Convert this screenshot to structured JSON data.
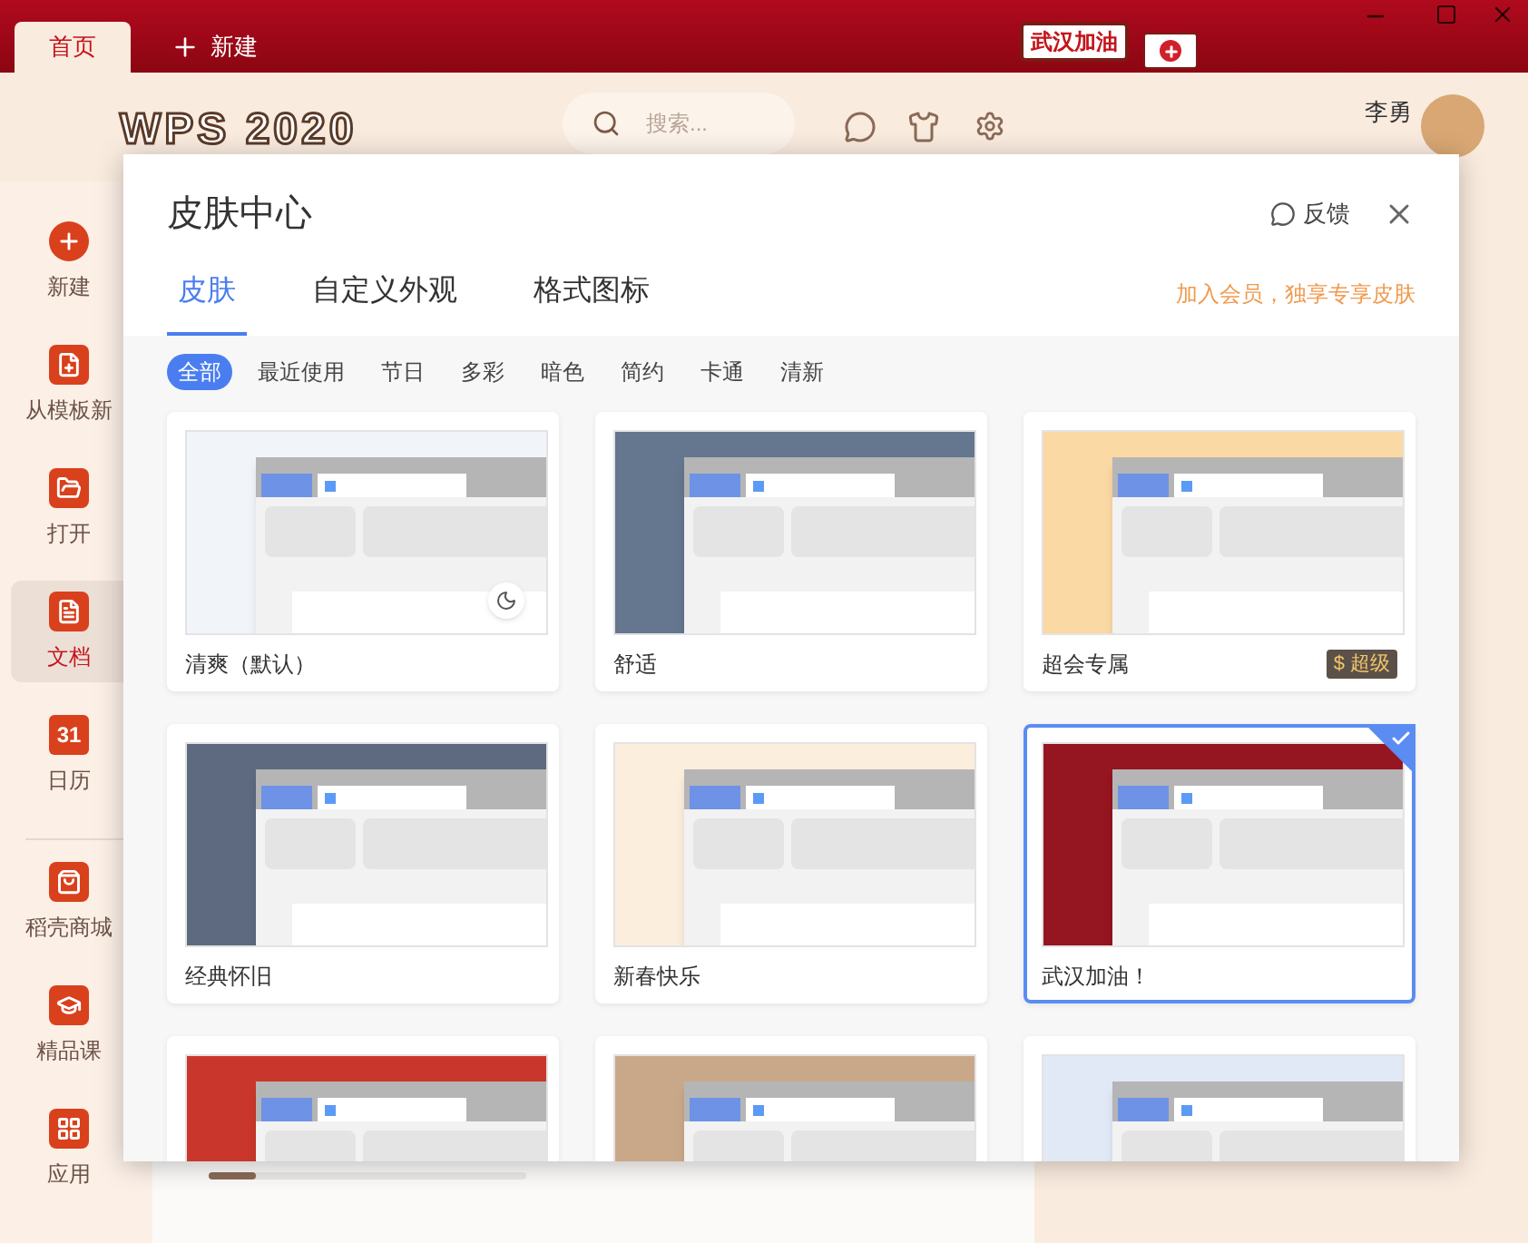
{
  "window": {
    "tabs": [
      {
        "label": "首页",
        "selected": true,
        "kind": "page"
      },
      {
        "label": "新建",
        "selected": false,
        "kind": "new"
      }
    ],
    "banner": "武汉加油"
  },
  "header": {
    "logo": "WPS 2020",
    "search": {
      "placeholder": "搜索..."
    },
    "user": {
      "name": "李勇"
    }
  },
  "sidebar": {
    "items": [
      {
        "label": "新建",
        "kind": "plus",
        "selected": false
      },
      {
        "label": "从模板新",
        "kind": "template",
        "selected": false
      },
      {
        "label": "打开",
        "kind": "folder",
        "selected": false
      },
      {
        "label": "文档",
        "kind": "doc",
        "selected": true
      },
      {
        "label": "日历",
        "kind": "calendar",
        "icon_text": "31",
        "selected": false
      },
      {
        "label": "稻壳商城",
        "kind": "shop",
        "selected": false
      },
      {
        "label": "精品课",
        "kind": "course",
        "selected": false
      },
      {
        "label": "应用",
        "kind": "apps",
        "selected": false
      }
    ]
  },
  "skin_center": {
    "title": "皮肤中心",
    "feedback": "反馈",
    "tabs": [
      {
        "label": "皮肤",
        "selected": true
      },
      {
        "label": "自定义外观",
        "selected": false
      },
      {
        "label": "格式图标",
        "selected": false
      }
    ],
    "promo": "加入会员，独享专享皮肤",
    "filters": [
      {
        "label": "全部",
        "selected": true
      },
      {
        "label": "最近使用",
        "selected": false
      },
      {
        "label": "节日",
        "selected": false
      },
      {
        "label": "多彩",
        "selected": false
      },
      {
        "label": "暗色",
        "selected": false
      },
      {
        "label": "简约",
        "selected": false
      },
      {
        "label": "卡通",
        "selected": false
      },
      {
        "label": "清新",
        "selected": false
      }
    ],
    "skins": [
      {
        "name": "清爽（默认）",
        "color": "#f1f5fa",
        "selected": false,
        "dark_mode": true
      },
      {
        "name": "舒适",
        "color": "#65768f",
        "selected": false,
        "dark_mode": false
      },
      {
        "name": "超会专属",
        "color": "#fbd9a4",
        "selected": false,
        "dark_mode": false,
        "badge": "$ 超级"
      },
      {
        "name": "经典怀旧",
        "color": "#5e6a80",
        "selected": false,
        "dark_mode": false
      },
      {
        "name": "新春快乐",
        "color": "#fbeedd",
        "selected": false,
        "dark_mode": false
      },
      {
        "name": "武汉加油！",
        "color": "#951520",
        "selected": true,
        "dark_mode": false
      },
      {
        "color": "#c9372c",
        "selected": false,
        "dark_mode": false
      },
      {
        "color": "#c9a88a",
        "selected": false,
        "dark_mode": false
      },
      {
        "color": "#e1e9f7",
        "selected": false,
        "dark_mode": false
      }
    ]
  }
}
